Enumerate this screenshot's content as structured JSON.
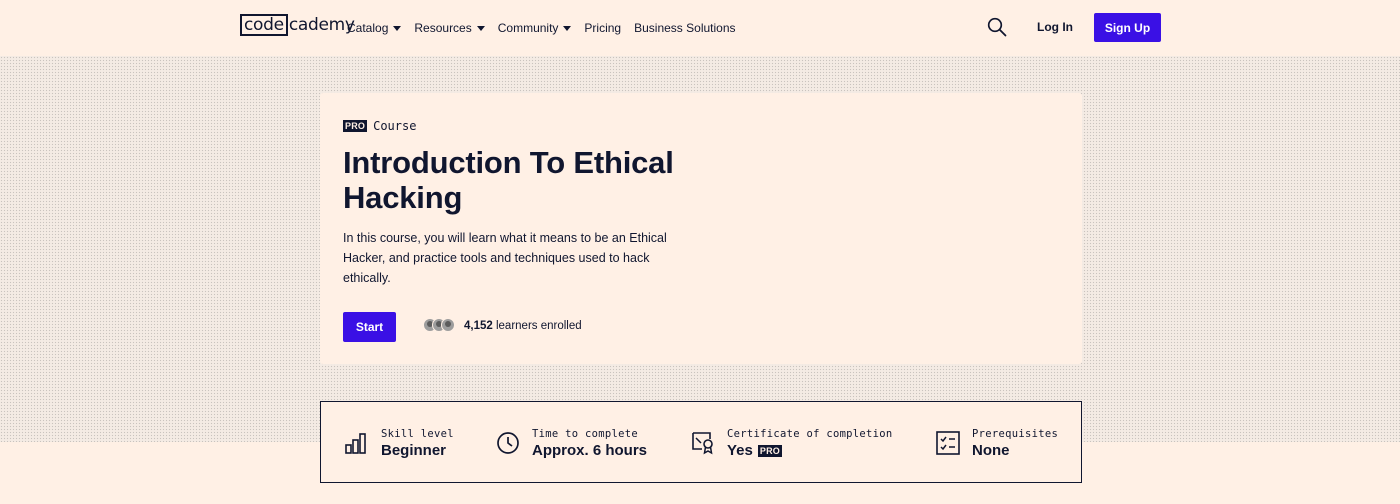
{
  "header": {
    "logo_code": "code",
    "logo_cademy": "cademy",
    "nav": [
      {
        "label": "Catalog",
        "dropdown": true
      },
      {
        "label": "Resources",
        "dropdown": true
      },
      {
        "label": "Community",
        "dropdown": true
      },
      {
        "label": "Pricing",
        "dropdown": false
      },
      {
        "label": "Business Solutions",
        "dropdown": false
      }
    ],
    "login_label": "Log In",
    "signup_label": "Sign Up"
  },
  "course": {
    "pro_badge": "PRO",
    "type": "Course",
    "title": "Introduction To Ethical Hacking",
    "description": "In this course, you will learn what it means to be an Ethical Hacker, and practice tools and techniques used to hack ethically.",
    "start_label": "Start",
    "learners_count": "4,152",
    "learners_suffix": " learners enrolled"
  },
  "stats": {
    "skill_label": "Skill level",
    "skill_value": "Beginner",
    "time_label": "Time to complete",
    "time_value": "Approx. 6 hours",
    "cert_label": "Certificate of completion",
    "cert_value": "Yes",
    "cert_badge": "PRO",
    "prereq_label": "Prerequisites",
    "prereq_value": "None"
  },
  "colors": {
    "background": "#fff0e5",
    "text": "#10162f",
    "accent": "#3a10e5"
  }
}
